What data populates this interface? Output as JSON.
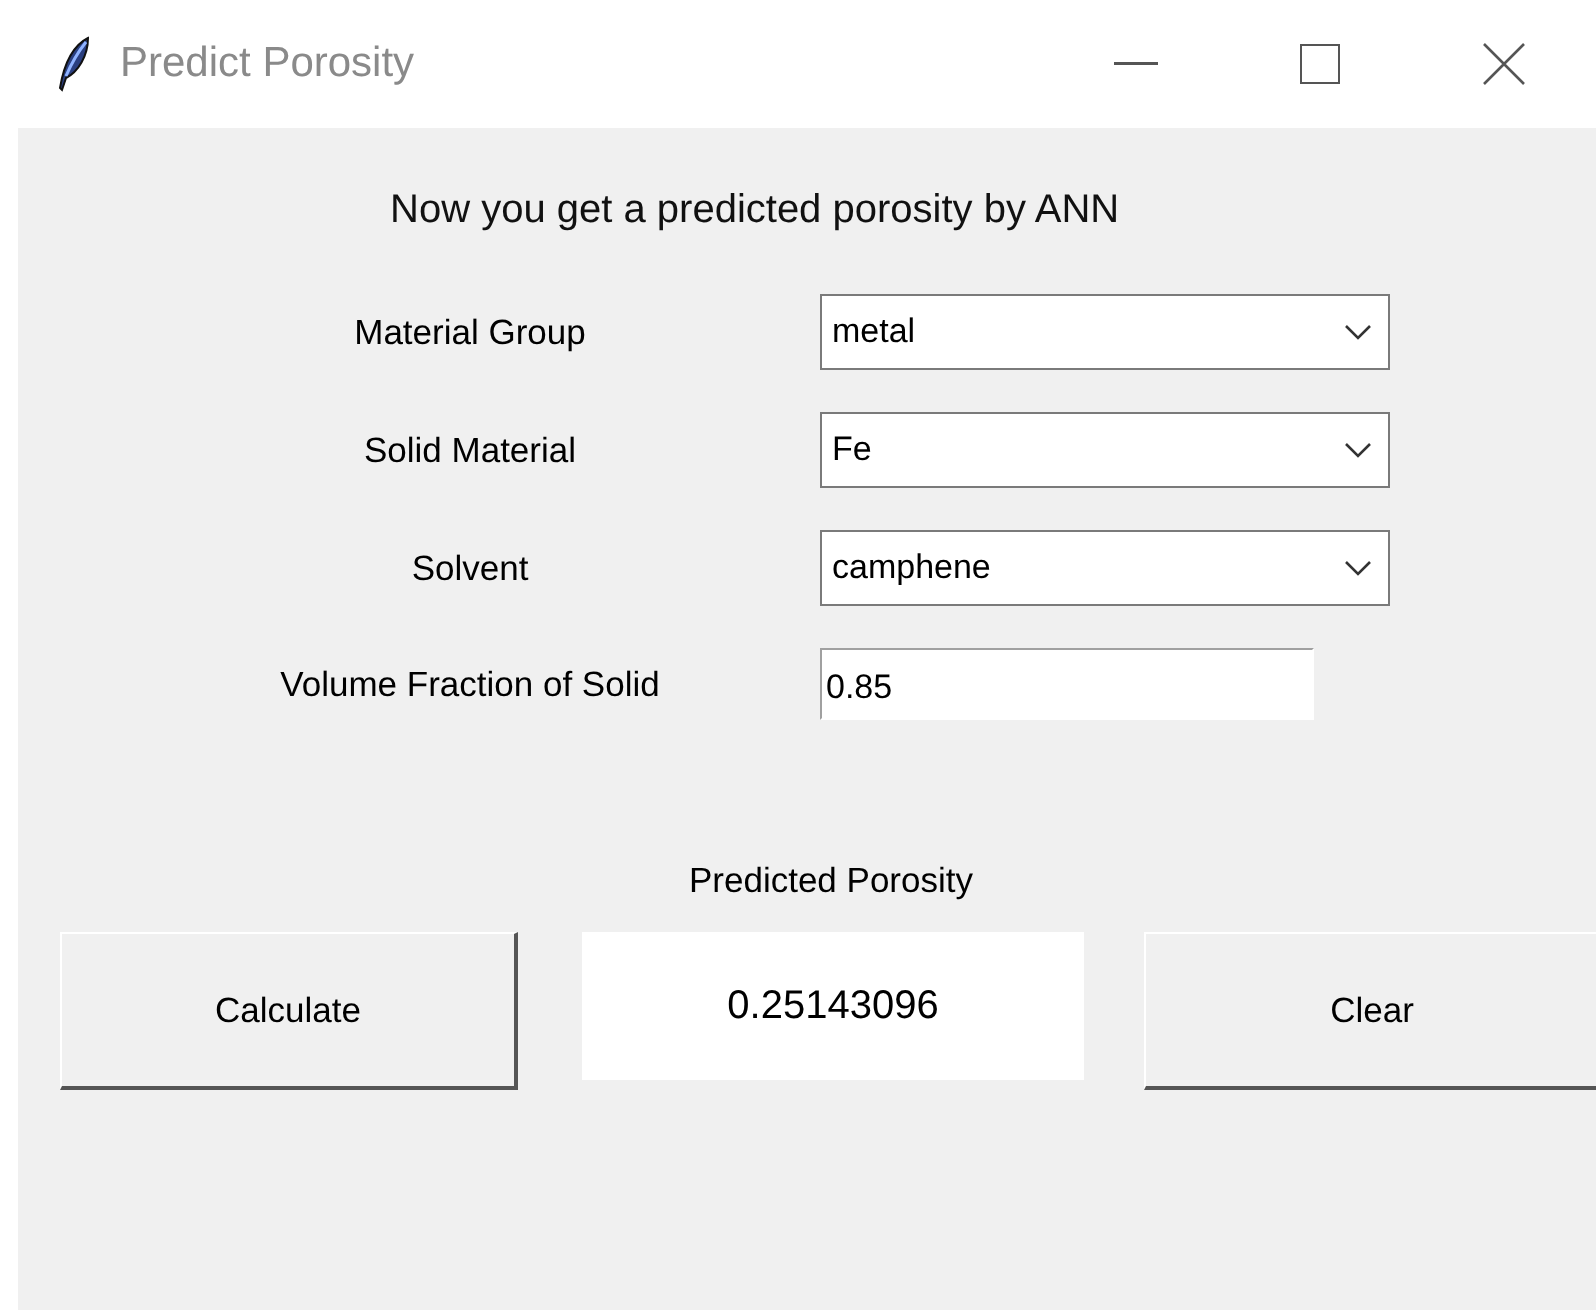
{
  "window": {
    "title": "Predict Porosity"
  },
  "heading": "Now you get a predicted porosity by ANN",
  "fields": [
    {
      "label": "Material Group",
      "kind": "combobox",
      "value": "metal"
    },
    {
      "label": "Solid Material",
      "kind": "combobox",
      "value": "Fe"
    },
    {
      "label": "Solvent",
      "kind": "combobox",
      "value": "camphene"
    },
    {
      "label": "Volume Fraction of Solid",
      "kind": "entry",
      "value": "0.85"
    }
  ],
  "result": {
    "label": "Predicted Porosity",
    "value": "0.25143096"
  },
  "buttons": [
    "Calculate",
    "Clear"
  ]
}
